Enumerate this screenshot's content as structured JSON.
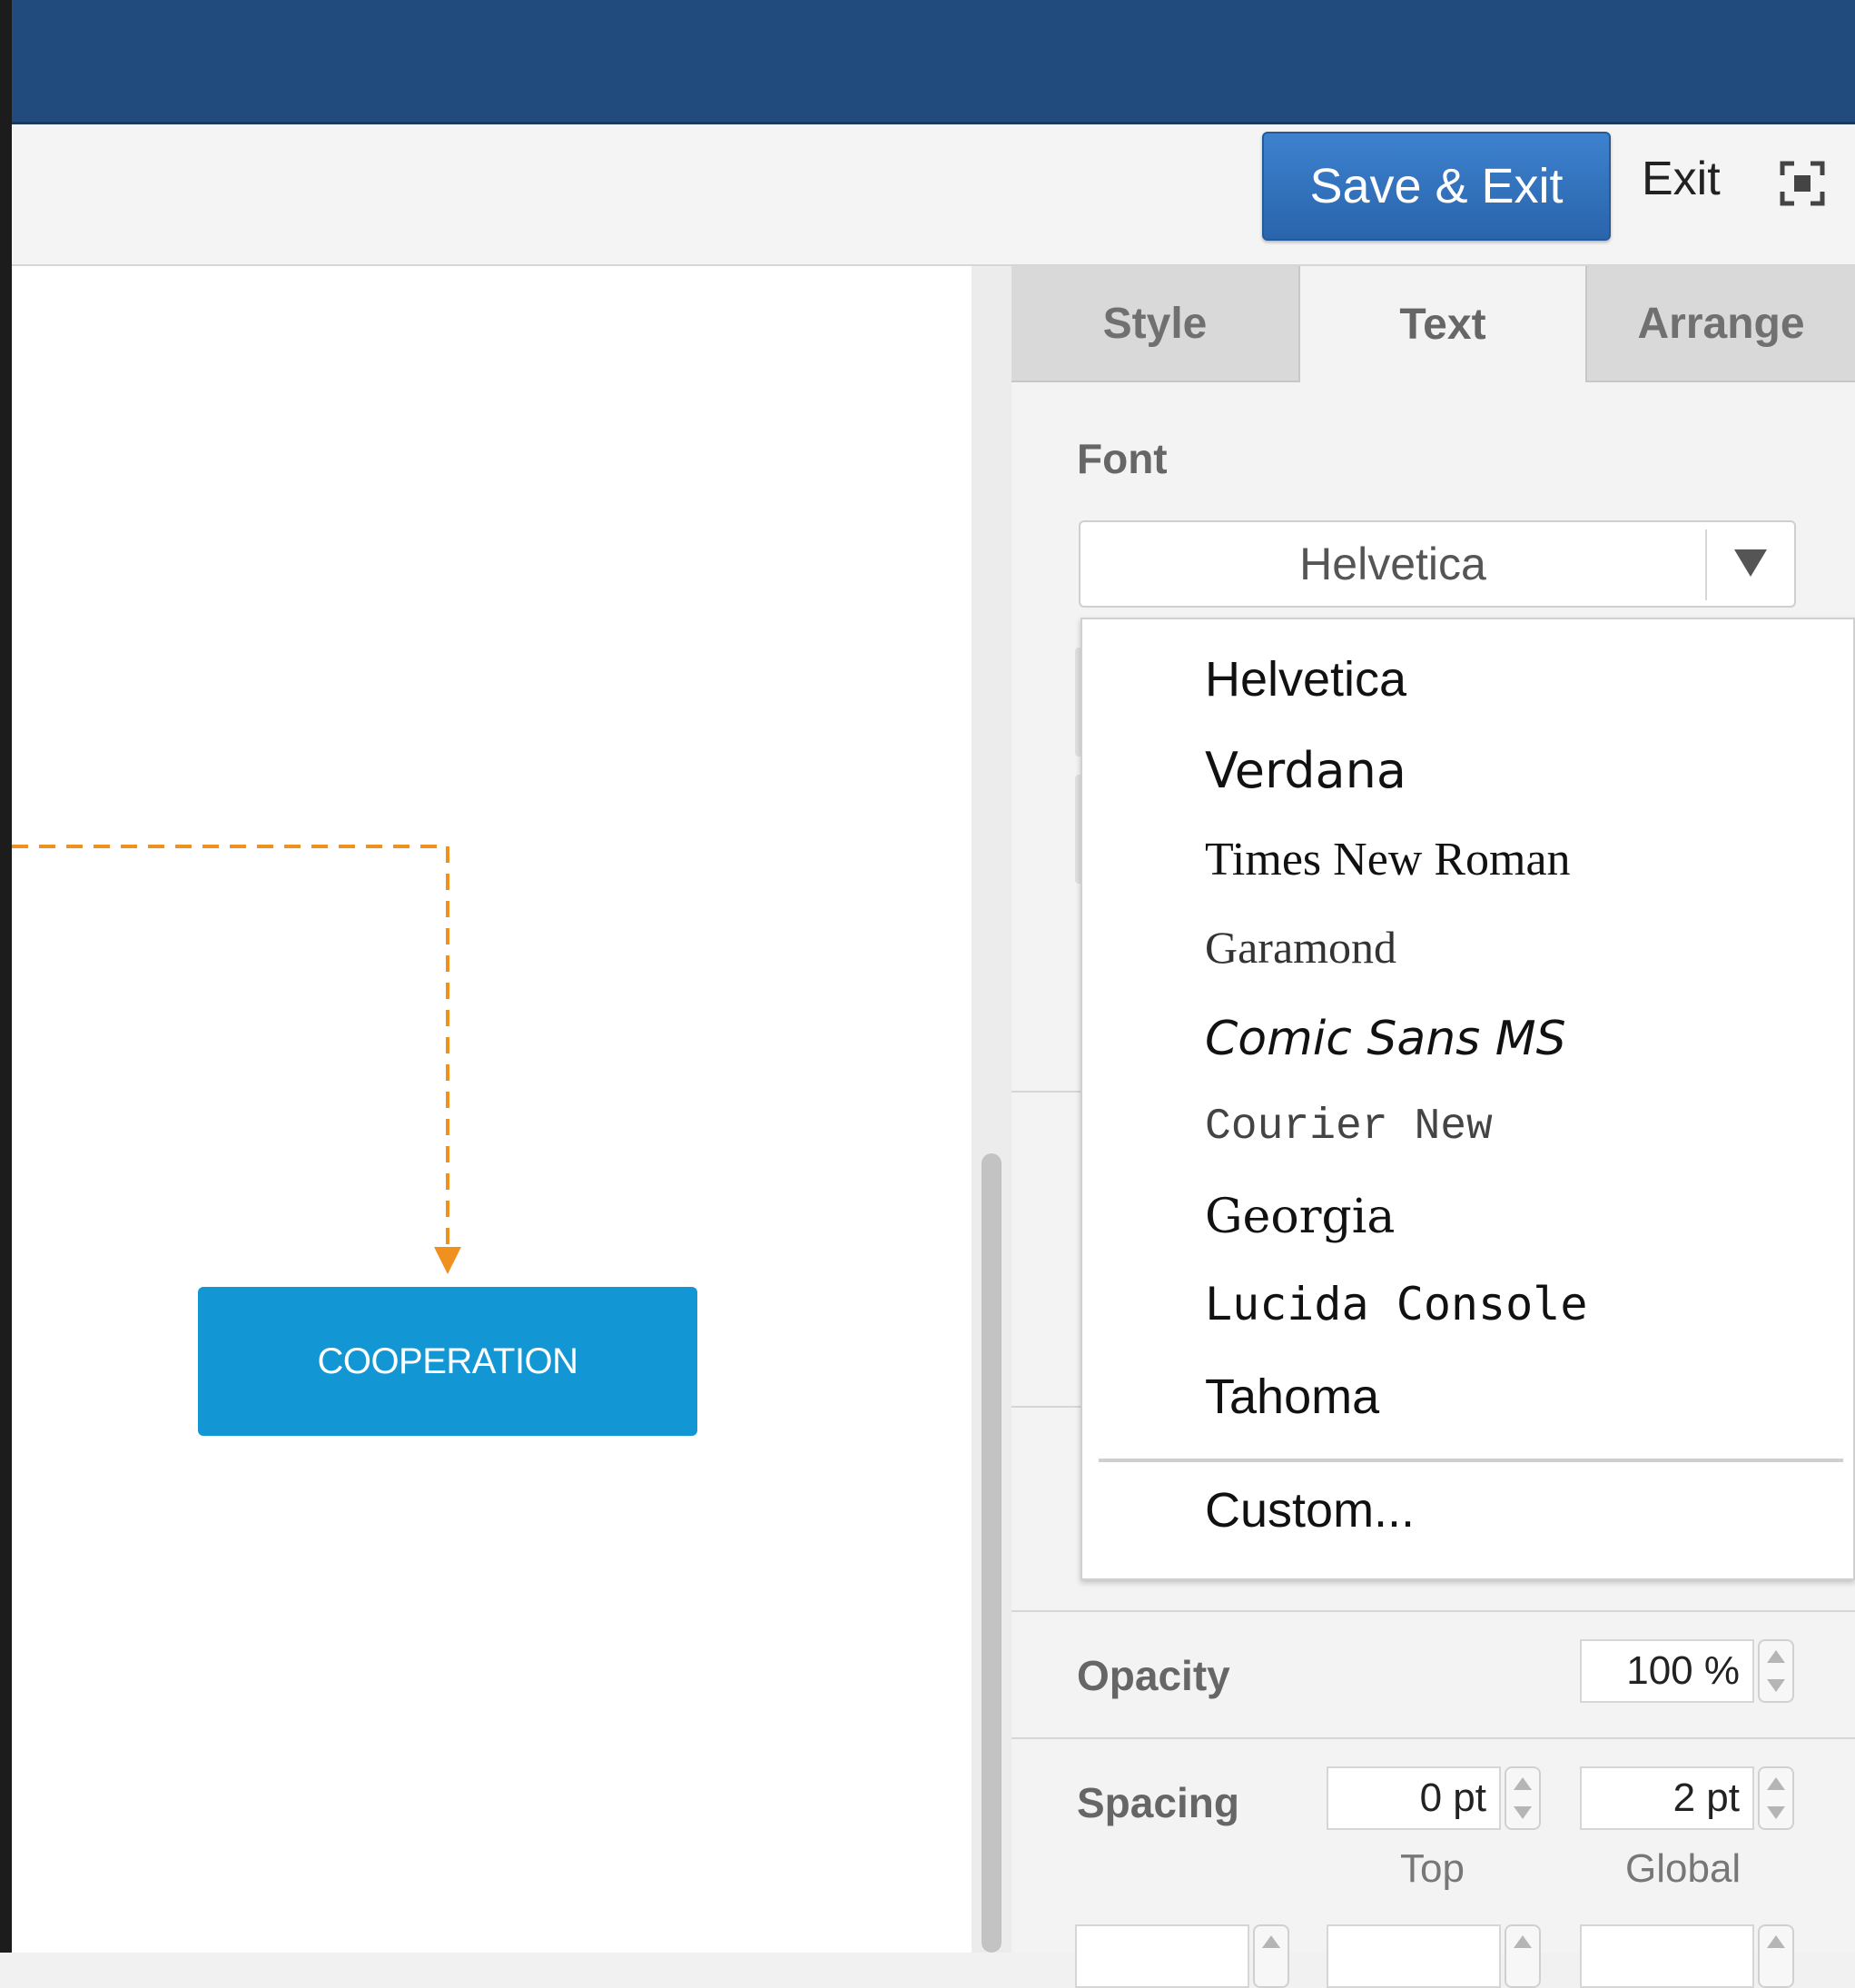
{
  "toolbar": {
    "save_exit_label": "Save & Exit",
    "exit_label": "Exit"
  },
  "diagram": {
    "node_label": "COOPERATION",
    "node_color": "#1396d4",
    "connector_color": "#f0901e"
  },
  "panel": {
    "tabs": [
      {
        "label": "Style",
        "active": false
      },
      {
        "label": "Text",
        "active": true
      },
      {
        "label": "Arrange",
        "active": false
      }
    ],
    "font_label": "Font",
    "font_selected": "Helvetica",
    "font_options": [
      "Helvetica",
      "Verdana",
      "Times New Roman",
      "Garamond",
      "Comic Sans MS",
      "Courier New",
      "Georgia",
      "Lucida Console",
      "Tahoma"
    ],
    "font_custom_option": "Custom...",
    "opacity_label": "Opacity",
    "opacity_value": "100 %",
    "spacing_label": "Spacing",
    "spacing_top_value": "0 pt",
    "spacing_global_value": "2 pt",
    "spacing_top_label": "Top",
    "spacing_global_label": "Global"
  },
  "colors": {
    "topbar": "#204b7c",
    "accent_button": "#2f6fbd"
  }
}
